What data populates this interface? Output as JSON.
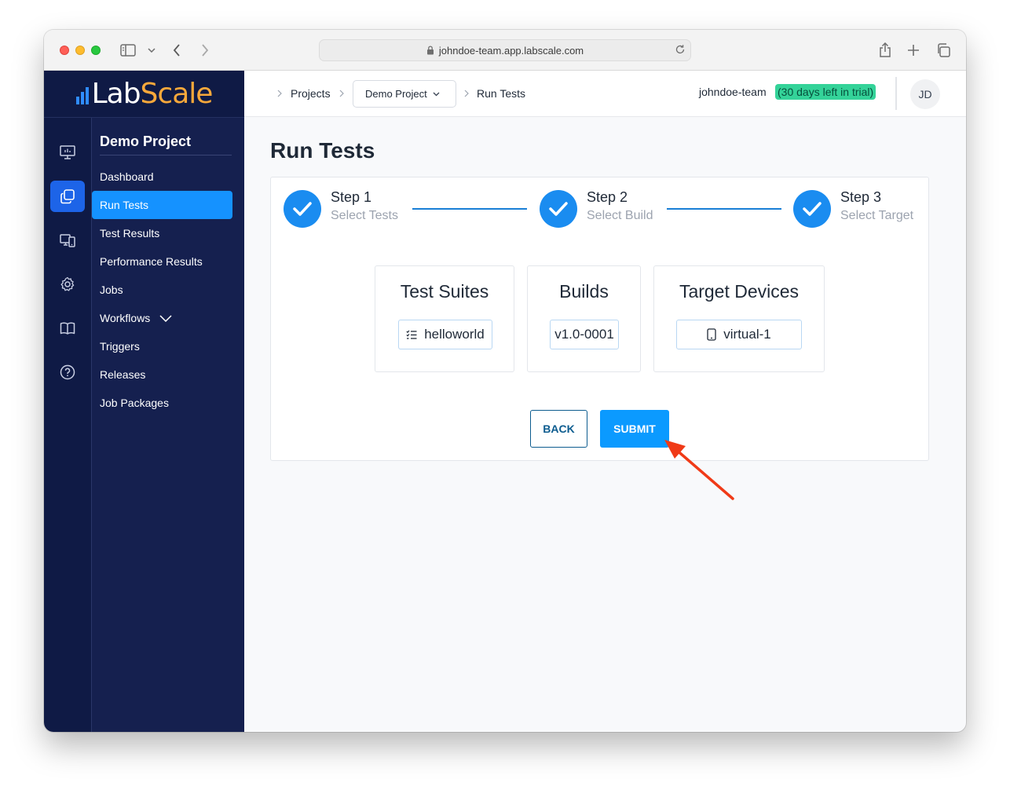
{
  "browser": {
    "url": "johndoe-team.app.labscale.com"
  },
  "brand": {
    "name_part1": "Lab",
    "name_part2": "Scale",
    "accent_color": "#f7a83b"
  },
  "rail": {
    "items": [
      {
        "icon": "monitor-chart-icon",
        "active": false
      },
      {
        "icon": "projects-copy-icon",
        "active": true
      },
      {
        "icon": "devices-icon",
        "active": false
      },
      {
        "icon": "gear-icon",
        "active": false
      },
      {
        "icon": "book-icon",
        "active": false
      },
      {
        "icon": "help-circle-icon",
        "active": false
      }
    ]
  },
  "sidebar": {
    "project_title": "Demo Project",
    "items": [
      {
        "label": "Dashboard",
        "active": false
      },
      {
        "label": "Run Tests",
        "active": true
      },
      {
        "label": "Test Results",
        "active": false
      },
      {
        "label": "Performance Results",
        "active": false
      },
      {
        "label": "Jobs",
        "active": false
      },
      {
        "label": "Workflows",
        "active": false,
        "expandable": true
      },
      {
        "label": "Triggers",
        "active": false
      },
      {
        "label": "Releases",
        "active": false
      },
      {
        "label": "Job Packages",
        "active": false
      }
    ]
  },
  "header": {
    "breadcrumb": {
      "projects": "Projects",
      "project_select": "Demo Project",
      "current": "Run Tests"
    },
    "team": "johndoe-team",
    "trial": "(30 days left in trial)",
    "avatar_initials": "JD"
  },
  "main": {
    "title": "Run Tests",
    "steps": [
      {
        "title": "Step 1",
        "subtitle": "Select Tests",
        "completed": true
      },
      {
        "title": "Step 2",
        "subtitle": "Select Build",
        "completed": true
      },
      {
        "title": "Step 3",
        "subtitle": "Select Target",
        "completed": true
      }
    ],
    "summary": {
      "suites": {
        "title": "Test Suites",
        "value": "helloworld",
        "icon": "checklist-icon"
      },
      "builds": {
        "title": "Builds",
        "value": "v1.0-0001"
      },
      "devices": {
        "title": "Target Devices",
        "value": "virtual-1",
        "icon": "phone-icon"
      }
    },
    "back_label": "BACK",
    "submit_label": "SUBMIT",
    "accent_color": "#0b9aff",
    "annotation_arrow_color": "#f03a17"
  }
}
